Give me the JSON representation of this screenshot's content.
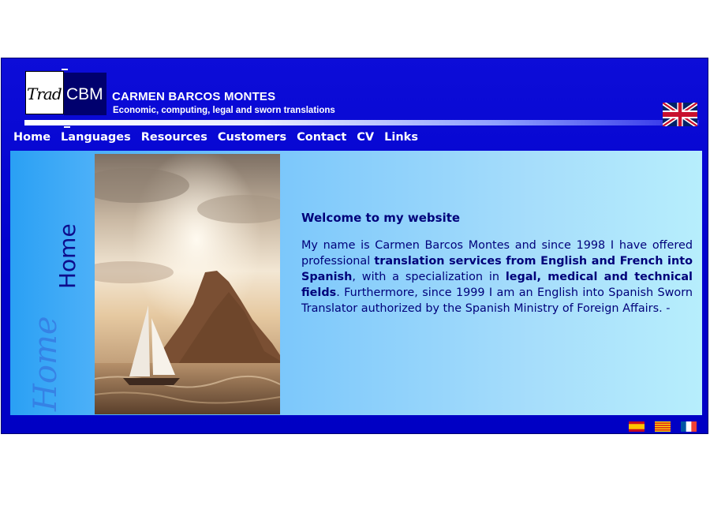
{
  "header": {
    "logo_left": "Trad",
    "logo_right": "CBM",
    "title": "CARMEN BARCOS MONTES",
    "subtitle": "Economic, computing, legal and sworn translations"
  },
  "nav": {
    "items": [
      "Home",
      "Languages",
      "Resources",
      "Customers",
      "Contact",
      "CV",
      "Links"
    ]
  },
  "sidebar": {
    "section_title": "Home"
  },
  "main": {
    "heading": "Welcome to my website",
    "paragraph": {
      "p1": "My name is Carmen Barcos Montes and since 1998 I have offered professional ",
      "b1": "translation services from English and French into Spanish",
      "p2": ", with a specialization in ",
      "b2": "legal, medical and technical fields",
      "p3": ". Furthermore, since 1999 I am an English into Spanish Sworn Translator authorized by the Spanish Ministry of Foreign Affairs. -"
    }
  },
  "icons": {
    "language_flag": "uk-flag-icon",
    "footer_flags": [
      "spain-flag-icon",
      "catalonia-flag-icon",
      "france-flag-icon"
    ]
  },
  "colors": {
    "frame_blue": "#0000cc",
    "text_navy": "#00007a",
    "content_light_blue": "#a6ddfb"
  }
}
